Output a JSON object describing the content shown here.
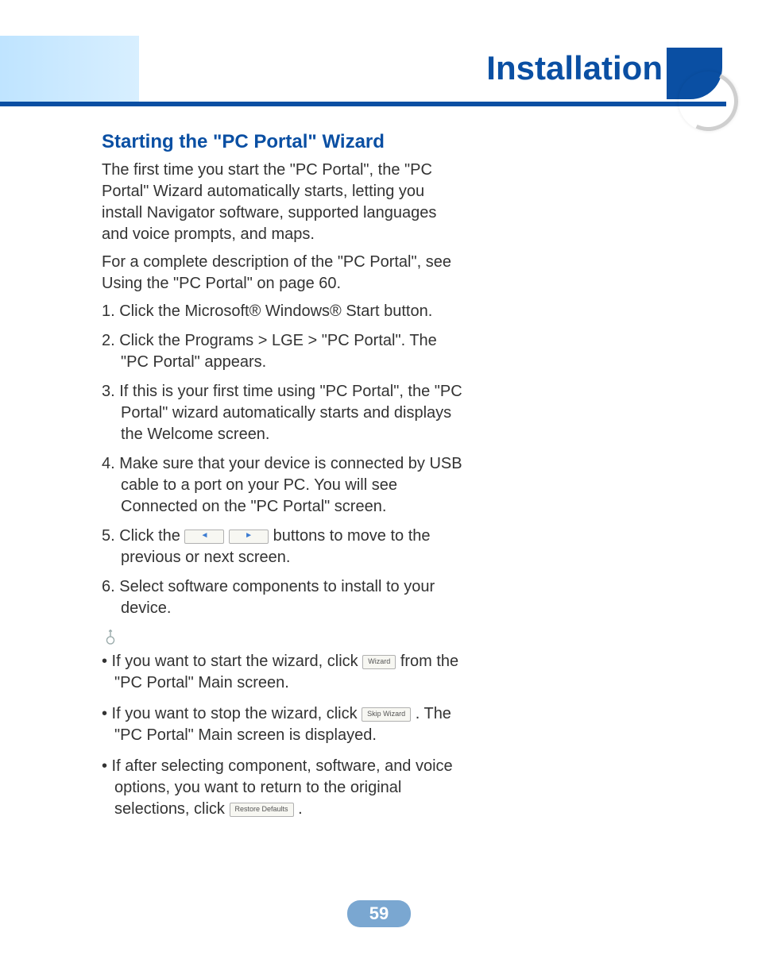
{
  "header": {
    "title": "Installation"
  },
  "section": {
    "title": "Starting the \"PC Portal\" Wizard",
    "intro1": "The first time you start the \"PC Portal\", the \"PC Portal\" Wizard automatically starts, letting you install Navigator software, supported languages and voice prompts, and maps.",
    "intro2": "For a complete description of the \"PC Portal\", see Using the \"PC Portal\" on page 60.",
    "steps": {
      "s1": "1. Click the Microsoft® Windows® Start button.",
      "s2": "2. Click the Programs > LGE > \"PC Portal\". The \"PC Portal\" appears.",
      "s3": "3. If this is your first time using \"PC Portal\", the \"PC Portal\" wizard automatically starts and displays the Welcome screen.",
      "s4": "4. Make sure that your device is connected by USB cable to a port on your PC. You will see Connected on the \"PC Portal\" screen.",
      "s5a": "5. Click the ",
      "s5b": " buttons to move to the previous or next screen.",
      "s6": "6. Select software components to install to your device."
    },
    "notes": {
      "n1a": "• If you want to start the wizard, click ",
      "n1b": " from the \"PC Portal\" Main screen.",
      "n2a": "• If you want to stop the wizard, click ",
      "n2b": ". The \"PC Portal\" Main screen is displayed.",
      "n3a": "• If after selecting component, software, and voice options, you want to return to the original selections, click ",
      "n3b": "."
    },
    "buttons": {
      "wizard": "Wizard",
      "skip": "Skip Wizard",
      "restore": "Restore Defaults"
    }
  },
  "page_number": "59"
}
